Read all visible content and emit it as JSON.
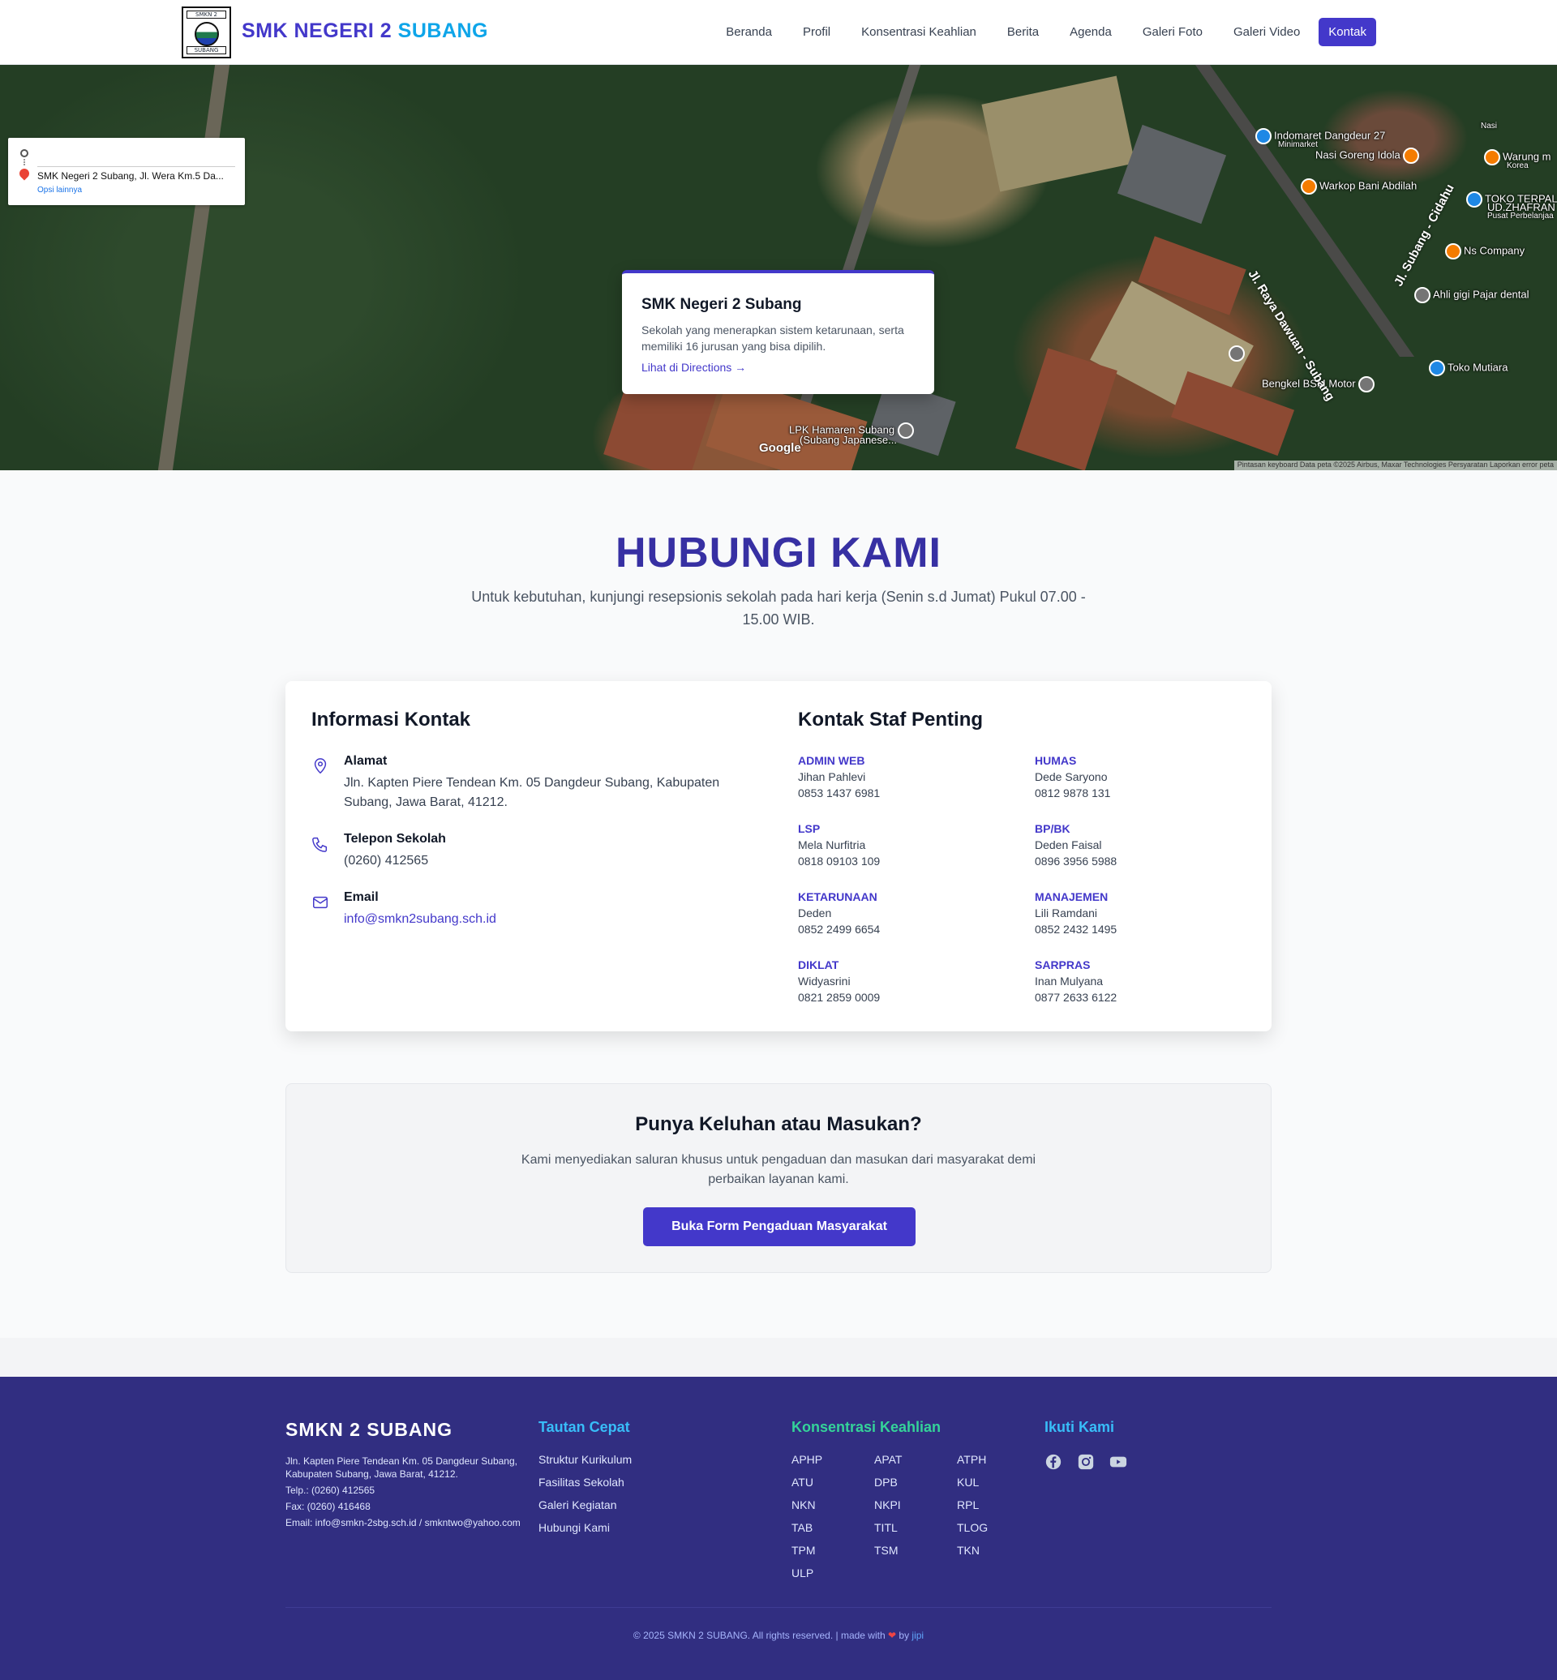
{
  "header": {
    "logo_top": "SMKN 2",
    "logo_bottom": "SUBANG",
    "brand_part1": "SMK NEGERI 2",
    "brand_part2": "SUBANG",
    "menu": [
      "Beranda",
      "Profil",
      "Konsentrasi Keahlian",
      "Berita",
      "Agenda",
      "Galeri Foto",
      "Galeri Video",
      "Kontak"
    ],
    "active_menu": "Kontak"
  },
  "map": {
    "directions_destination": "SMK Negeri 2 Subang, Jl. Wera Km.5 Da...",
    "directions_more": "Opsi lainnya",
    "card_title": "SMK Negeri 2 Subang",
    "card_desc": "Sekolah yang menerapkan sistem ketarunaan, serta memiliki 16 jurusan yang bisa dipilih.",
    "card_link": "Lihat di Directions →",
    "pois": [
      "Indomaret Dangdeur 27",
      "Minimarket",
      "Nasi Goreng Idola",
      "Warkop Bani Abdilah",
      "Warung m",
      "Korea",
      "TOKO TERPAL",
      "UD.ZHAFRAN",
      "Pusat Perbelanjaa",
      "Ns Company",
      "Ahli gigi Pajar dental",
      "Toko Mutiara",
      "Bengkel BSM Motor",
      "LPK Hamaren Subang",
      "(Subang Japanese...",
      "Nasi"
    ],
    "streets": [
      "Jl. Raya Dawuan - Subang",
      "Jl. Subang - Cidahu"
    ],
    "google": "Google",
    "attribution": "Pintasan keyboard   Data peta ©2025 Airbus, Maxar Technologies   Persyaratan   Laporkan error peta"
  },
  "contact": {
    "title": "HUBUNGI KAMI",
    "subtitle": "Untuk kebutuhan, kunjungi resepsionis sekolah pada hari kerja (Senin s.d Jumat) Pukul 07.00 - 15.00 WIB.",
    "info_heading": "Informasi Kontak",
    "address_label": "Alamat",
    "address_value": "Jln. Kapten Piere Tendean Km. 05 Dangdeur Subang, Kabupaten Subang, Jawa Barat, 41212.",
    "phone_label": "Telepon Sekolah",
    "phone_value": "(0260) 412565",
    "email_label": "Email",
    "email_value": "info@smkn2subang.sch.id",
    "staff_heading": "Kontak Staf Penting",
    "staff": [
      {
        "role": "ADMIN WEB",
        "name": "Jihan Pahlevi",
        "phone": "0853 1437 6981"
      },
      {
        "role": "HUMAS",
        "name": "Dede Saryono",
        "phone": "0812 9878 131"
      },
      {
        "role": "LSP",
        "name": "Mela Nurfitria",
        "phone": "0818 09103 109"
      },
      {
        "role": "BP/BK",
        "name": "Deden Faisal",
        "phone": "0896 3956 5988"
      },
      {
        "role": "KETARUNAAN",
        "name": "Deden",
        "phone": "0852 2499 6654"
      },
      {
        "role": "MANAJEMEN",
        "name": "Lili Ramdani",
        "phone": "0852 2432 1495"
      },
      {
        "role": "DIKLAT",
        "name": "Widyasrini",
        "phone": "0821 2859 0009"
      },
      {
        "role": "SARPRAS",
        "name": "Inan Mulyana",
        "phone": "0877 2633 6122"
      }
    ]
  },
  "complaint": {
    "title": "Punya Keluhan atau Masukan?",
    "desc": "Kami menyediakan saluran khusus untuk pengaduan dan masukan dari masyarakat demi perbaikan layanan kami.",
    "button": "Buka Form Pengaduan Masyarakat"
  },
  "footer": {
    "brand": "SMKN 2 SUBANG",
    "address": "Jln. Kapten Piere Tendean Km. 05 Dangdeur Subang, Kabupaten Subang, Jawa Barat, 41212.",
    "phone": "Telp.: (0260) 412565",
    "fax": "Fax: (0260) 416468",
    "email": "Email: info@smkn-2sbg.sch.id / smkntwo@yahoo.com",
    "quick_title": "Tautan Cepat",
    "quick_links": [
      "Struktur Kurikulum",
      "Fasilitas Sekolah",
      "Galeri Kegiatan",
      "Hubungi Kami"
    ],
    "konsentrasi_title": "Konsentrasi Keahlian",
    "konsentrasi": [
      "APHP",
      "APAT",
      "ATPH",
      "ATU",
      "DPB",
      "KUL",
      "NKN",
      "NKPI",
      "RPL",
      "TAB",
      "TITL",
      "TLOG",
      "TPM",
      "TSM",
      "TKN",
      "ULP"
    ],
    "follow_title": "Ikuti Kami",
    "social": [
      "facebook-icon",
      "instagram-icon",
      "youtube-icon"
    ],
    "copyright": "© 2025 SMKN 2 SUBANG. All rights reserved. | made with",
    "by": "by",
    "author": "jipi"
  },
  "colors": {
    "primary": "#4338ca",
    "accent": "#0ea5e9",
    "footer_bg": "#312e81",
    "footer_quick_title": "#38bdf8",
    "footer_konsentrasi_title": "#34d399",
    "footer_follow_title": "#38bdf8"
  }
}
